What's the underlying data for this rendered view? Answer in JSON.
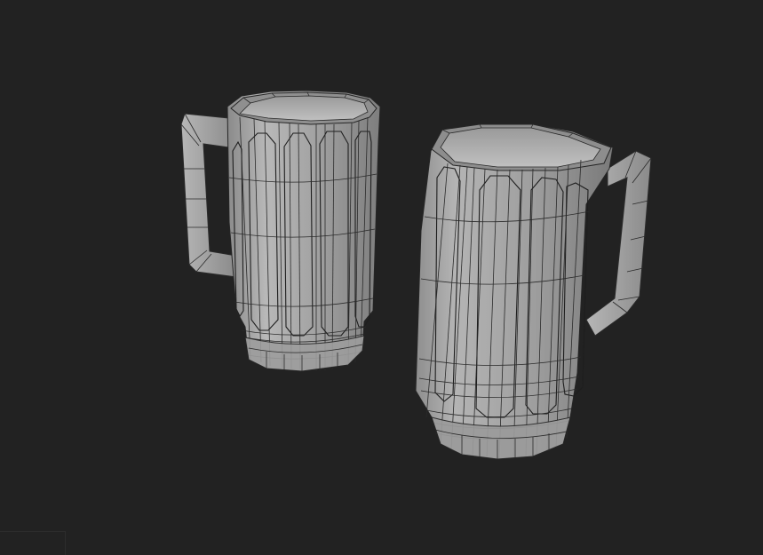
{
  "scene": {
    "background": "#222222",
    "objects": [
      {
        "name": "mug-left",
        "shading": "wireframe-on-shaded",
        "handle_side": "left"
      },
      {
        "name": "mug-right",
        "shading": "wireframe-on-shaded",
        "handle_side": "right"
      }
    ],
    "mesh_color": "#a8a8a8",
    "wire_color": "#2a2a2a"
  }
}
